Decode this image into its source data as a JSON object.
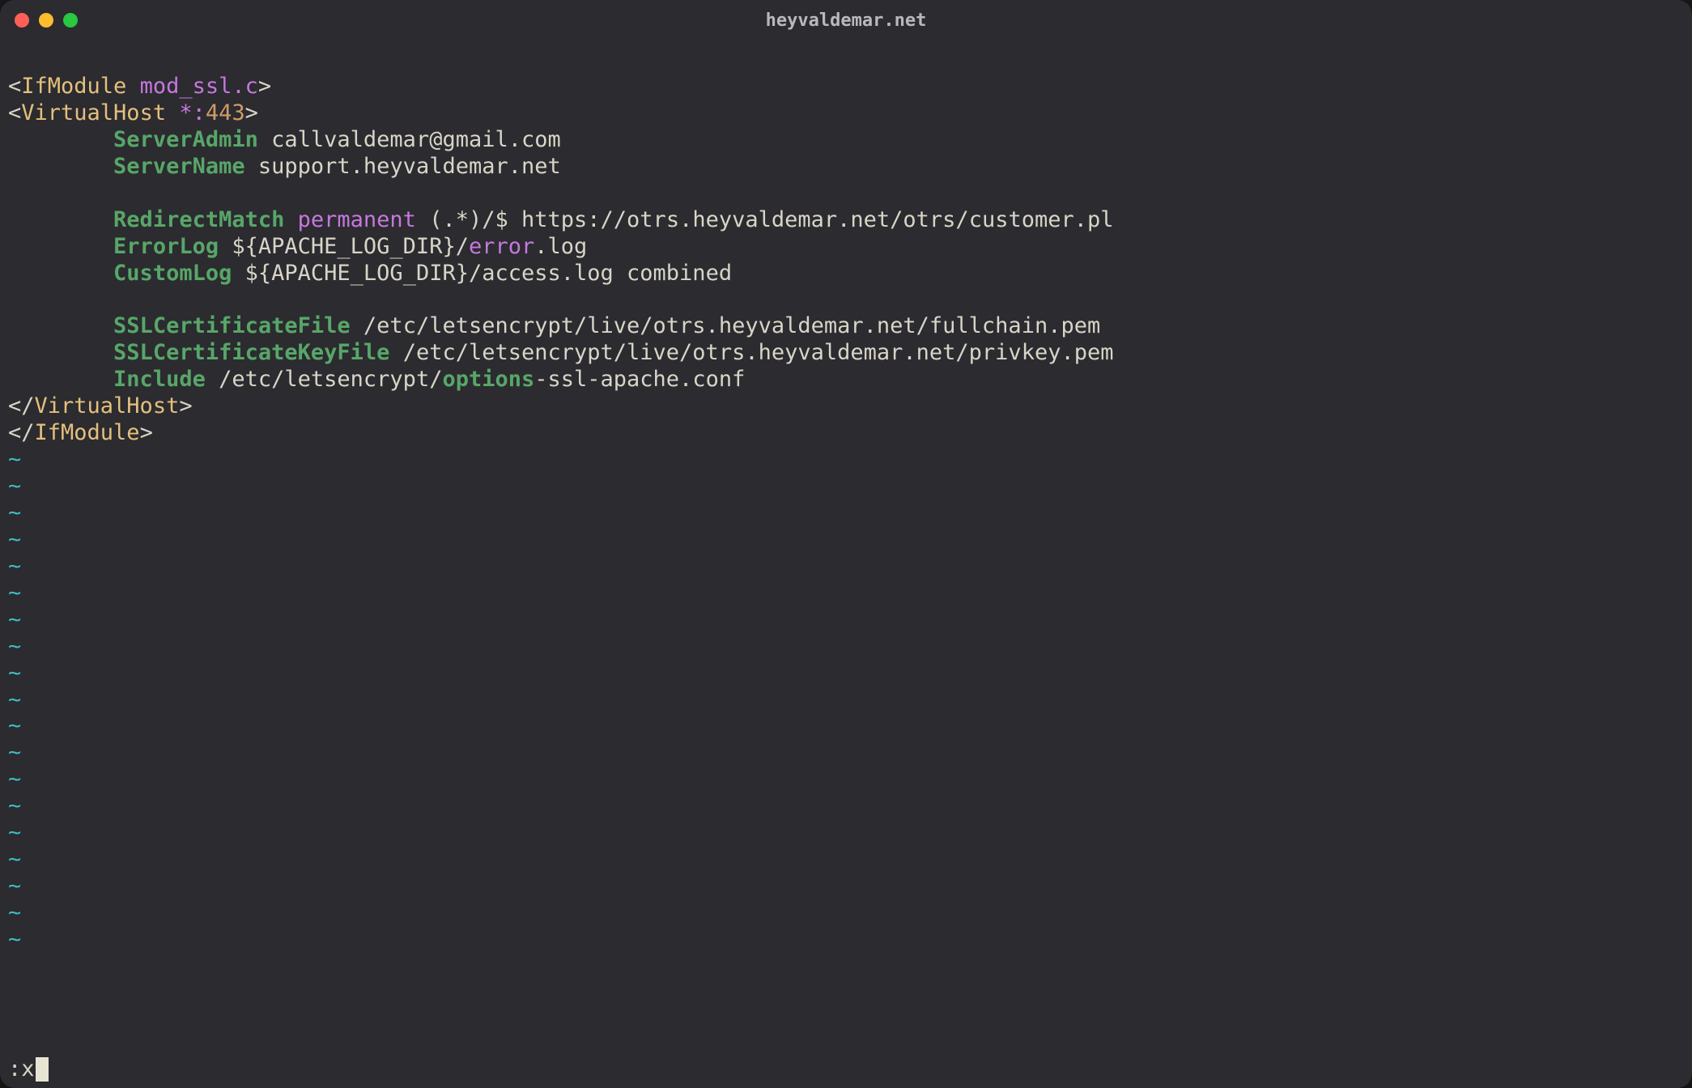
{
  "window": {
    "title": "heyvaldemar.net"
  },
  "tokens": {
    "lineStart": "<",
    "lineEnd": ">",
    "closeSlash": "</",
    "ifmodule": "IfModule",
    "modssl": "mod_ssl.c",
    "virtualhost": "VirtualHost",
    "starColon": "*:",
    "port": "443",
    "serverAdmin": "ServerAdmin",
    "serverAdminVal": "callvaldemar@gmail.com",
    "serverName": "ServerName",
    "serverNameVal": "support.heyvaldemar.net",
    "redirectMatch": "RedirectMatch",
    "permanent": "permanent",
    "redirectPattern": "(.*)/$ https://otrs.heyvaldemar.net/otrs/customer.pl",
    "errorLog": "ErrorLog",
    "errorLogPre": "${APACHE_LOG_DIR}/",
    "errorWord": "error",
    "errorLogPost": ".log",
    "customLog": "CustomLog",
    "customLogVal": "${APACHE_LOG_DIR}/access.log combined",
    "sslCert": "SSLCertificateFile",
    "sslCertVal": "/etc/letsencrypt/live/otrs.heyvaldemar.net/fullchain.pem",
    "sslKey": "SSLCertificateKeyFile",
    "sslKeyVal": "/etc/letsencrypt/live/otrs.heyvaldemar.net/privkey.pem",
    "include": "Include",
    "includePre": "/etc/letsencrypt/",
    "optionsWord": "options",
    "includePost": "-ssl-apache.conf"
  },
  "indent": "        ",
  "tilde": "~",
  "tildeCount": 19,
  "command": ":x"
}
